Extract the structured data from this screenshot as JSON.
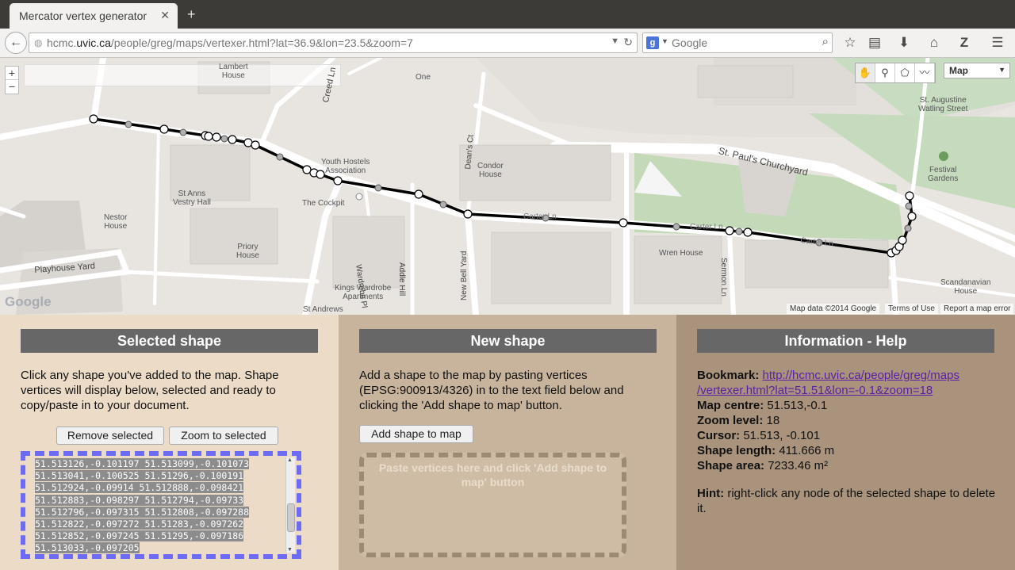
{
  "browser": {
    "tab_title": "Mercator vertex generator",
    "tab_close": "✕",
    "new_tab": "+",
    "back": "←",
    "url_prefix": "hcmc.",
    "url_host": "uvic.ca",
    "url_path": "/people/greg/maps/vertexer.html?lat=36.9&lon=23.5&zoom=7",
    "search_placeholder": "Google",
    "search_engine_letter": "g"
  },
  "map": {
    "zoom_in": "+",
    "zoom_out": "−",
    "map_type": "Map",
    "labels": {
      "lambert": "Lambert\nHouse",
      "one": "One",
      "st_augustine": "St. Augustine\nWatling Street",
      "youth_hostels": "Youth Hostels\nAssociation",
      "condor": "Condor\nHouse",
      "st_anns": "St Anns\nVestry Hall",
      "the_cockpit": "The Cockpit",
      "festival_gardens": "Festival\nGardens",
      "nestor": "Nestor\nHouse",
      "priory": "Priory\nHouse",
      "wren": "Wren House",
      "scandanavian": "Scandanavian\nHouse",
      "kings_wardrobe": "Kings Wardrobe\nApartments",
      "st_andrews": "St Andrews"
    },
    "streets": {
      "creed_ln": "Creed Ln",
      "deans_ct": "Dean's Ct",
      "st_pauls": "St. Paul's Churchyard",
      "wardrobe_pl": "Wardrobe Pl",
      "addle_hill": "Addle Hill",
      "new_bell_yard": "New Bell Yard",
      "sermon_ln": "Sermon Ln",
      "playhouse_yard": "Playhouse Yard",
      "carter_ln_1": "Carter Ln",
      "carter_ln_2": "Carter Ln",
      "carter_ln_3": "Carter Ln"
    },
    "google_logo": "Google",
    "footer": {
      "map_data": "Map data ©2014 Google",
      "terms": "Terms of Use",
      "report": "Report a map error"
    }
  },
  "selected_panel": {
    "title": "Selected shape",
    "instructions": "Click any shape you've added to the map. Shape vertices will display below, selected and ready to copy/paste in to your document.",
    "remove_button": "Remove selected",
    "zoom_button": "Zoom to selected",
    "vertices": [
      "51.513126,-0.101197 51.513099,-0.101073",
      "51.513041,-0.100525 51.51296,-0.100191",
      "51.512924,-0.09914 51.512888,-0.098421",
      "51.512883,-0.098297 51.512794,-0.09733",
      "51.512796,-0.097315 51.512808,-0.097288",
      "51.512822,-0.097272 51.51283,-0.097262",
      "51.512852,-0.097245 51.51295,-0.097186",
      "51.513033,-0.097205"
    ]
  },
  "new_panel": {
    "title": "New shape",
    "instructions": "Add a shape to the map by pasting vertices (EPSG:900913/4326) in to the text field below and clicking the 'Add shape to map' button.",
    "add_button": "Add shape to map",
    "textarea_placeholder": "Paste vertices here and click 'Add shape to map' button"
  },
  "info_panel": {
    "title": "Information - Help",
    "bookmark_label": "Bookmark:",
    "bookmark_url_line1": "http://hcmc.uvic.ca/people/greg/maps",
    "bookmark_url_line2": "/vertexer.html?lat=51.51&lon=-0.1&zoom=18",
    "centre_label": "Map centre:",
    "centre_value": "51.513,-0.1",
    "zoom_label": "Zoom level:",
    "zoom_value": "18",
    "cursor_label": "Cursor:",
    "cursor_value": "51.513, -0.101",
    "length_label": "Shape length:",
    "length_value": "411.666 m",
    "area_label": "Shape area:",
    "area_value": "7233.46 m²",
    "hint_label": "Hint:",
    "hint_text": "right-click any node of the selected shape to delete it."
  }
}
